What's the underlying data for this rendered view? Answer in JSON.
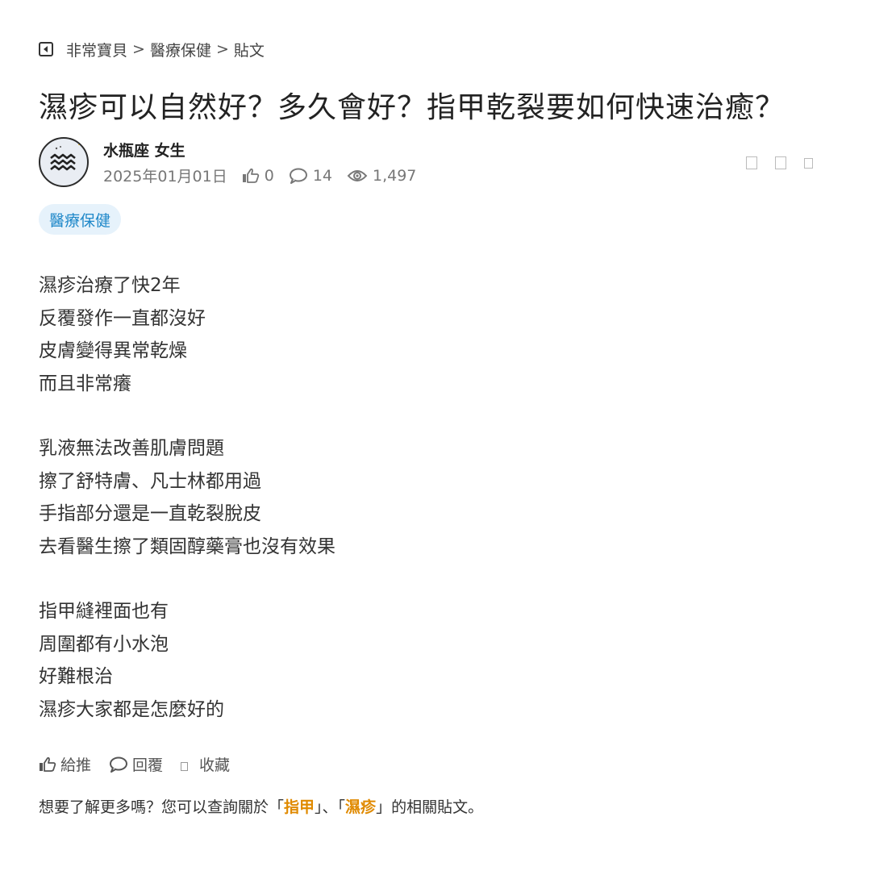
{
  "breadcrumb": {
    "items": [
      "非常寶貝",
      "醫療保健",
      "貼文"
    ],
    "separator": ">"
  },
  "post": {
    "title": "濕疹可以自然好？多久會好？指甲乾裂要如何快速治癒？",
    "author": "水瓶座 女生",
    "date": "2025年01月01日",
    "likes": "0",
    "comments": "14",
    "views": "1,497",
    "tag": "醫療保健",
    "paragraphs": [
      [
        "濕疹治療了快2年",
        "反覆發作一直都沒好",
        "皮膚變得異常乾燥",
        "而且非常癢"
      ],
      [
        "乳液無法改善肌膚問題",
        "擦了舒特膚、凡士林都用過",
        "手指部分還是一直乾裂脫皮",
        "去看醫生擦了類固醇藥膏也沒有效果"
      ],
      [
        "指甲縫裡面也有",
        "周圍都有小水泡",
        "好難根治",
        "濕疹大家都是怎麼好的"
      ]
    ]
  },
  "actions": {
    "like": "給推",
    "reply": "回覆",
    "save": "收藏"
  },
  "related": {
    "prefix": "想要了解更多嗎？您可以查詢關於「",
    "kw1": "指甲",
    "mid": "」、「",
    "kw2": "濕疹",
    "suffix": "」的相關貼文。"
  },
  "icons": {
    "back": "back-square-icon",
    "like": "thumb-up-icon",
    "comment": "speech-bubble-icon",
    "view": "eye-icon"
  },
  "colors": {
    "tag_bg": "#e6f2fb",
    "tag_text": "#1f88c9",
    "keyword": "#e08a00"
  }
}
